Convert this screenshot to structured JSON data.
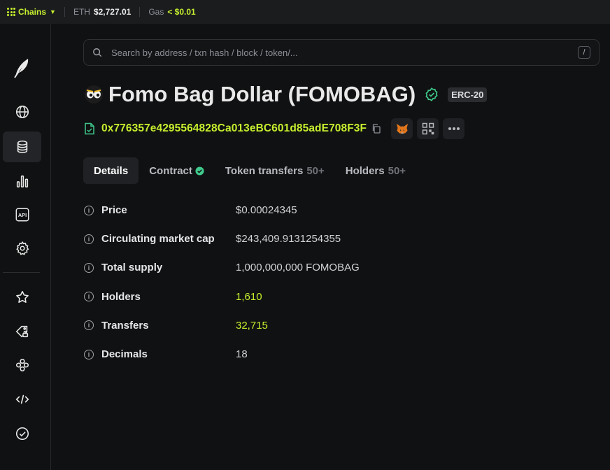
{
  "topbar": {
    "chains_label": "Chains",
    "eth_label": "ETH",
    "eth_price": "$2,727.01",
    "gas_label": "Gas",
    "gas_value": "< $0.01"
  },
  "sidebar": {
    "items": [
      {
        "icon": "globe-icon",
        "active": false
      },
      {
        "icon": "coins-icon",
        "active": true
      },
      {
        "icon": "bar-chart-icon",
        "active": false
      },
      {
        "icon": "api-icon",
        "label": "API",
        "active": false
      },
      {
        "icon": "gear-icon",
        "active": false
      },
      {
        "icon": "star-icon",
        "active": false
      },
      {
        "icon": "tag-lock-icon",
        "active": false
      },
      {
        "icon": "apps-icon",
        "active": false
      },
      {
        "icon": "code-icon",
        "active": false
      },
      {
        "icon": "check-circle-icon",
        "active": false
      }
    ]
  },
  "search": {
    "placeholder": "Search by address / txn hash / block / token/...",
    "shortcut": "/"
  },
  "token": {
    "name": "Fomo Bag Dollar (FOMOBAG)",
    "standard": "ERC-20",
    "address": "0x776357e4295564828Ca013eBC601d85adE708F3F"
  },
  "tabs": [
    {
      "label": "Details",
      "count": "",
      "active": true
    },
    {
      "label": "Contract",
      "count": "",
      "verified": true,
      "active": false
    },
    {
      "label": "Token transfers",
      "count": "50+",
      "active": false
    },
    {
      "label": "Holders",
      "count": "50+",
      "active": false
    }
  ],
  "details": [
    {
      "label": "Price",
      "value": "$0.00024345",
      "link": false
    },
    {
      "label": "Circulating market cap",
      "value": "$243,409.9131254355",
      "link": false
    },
    {
      "label": "Total supply",
      "value": "1,000,000,000 FOMOBAG",
      "link": false
    },
    {
      "label": "Holders",
      "value": "1,610",
      "link": true
    },
    {
      "label": "Transfers",
      "value": "32,715",
      "link": true
    },
    {
      "label": "Decimals",
      "value": "18",
      "link": false
    }
  ],
  "colors": {
    "accent": "#c6ef2e",
    "background": "#101112",
    "verified": "#3fc98c"
  }
}
